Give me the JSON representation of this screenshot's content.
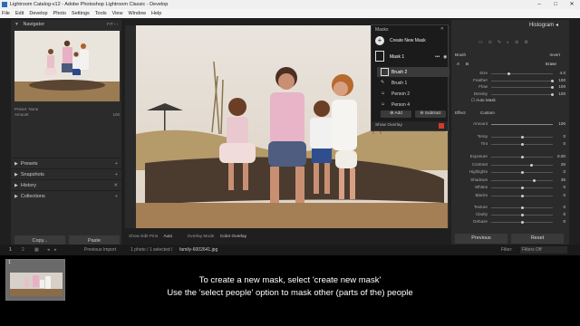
{
  "window": {
    "title": "Lightroom Catalog-v12 - Adobe Photoshop Lightroom Classic - Develop",
    "minimize": "–",
    "maximize": "□",
    "close": "✕"
  },
  "menu": [
    "File",
    "Edit",
    "Develop",
    "Photo",
    "Settings",
    "Tools",
    "View",
    "Window",
    "Help"
  ],
  "left_panel": {
    "navigator": "Navigator",
    "zoom_options": "FIT  ‹  ›",
    "preset_label": "Preset",
    "preset_value": "None",
    "preset_amount": "Amount",
    "preset_amount_value": "100",
    "sections": [
      "Presets",
      "Snapshots",
      "History",
      "Collections"
    ],
    "copy_button": "Copy...",
    "paste_button": "Paste"
  },
  "toolbar": {
    "show_edit_pins": "Show Edit Pins",
    "edit_pins_value": "Auto",
    "overlay_mode": "Overlay Mode",
    "overlay_mode_value": "Color Overlay"
  },
  "masks_panel": {
    "title": "Masks",
    "create_new": "Create New Mask",
    "items": [
      {
        "label": "Mask 1",
        "indent": 0
      },
      {
        "label": "Brush 2",
        "indent": 1
      },
      {
        "label": "Brush 1",
        "indent": 1
      },
      {
        "label": "Person 2",
        "indent": 1
      },
      {
        "label": "Person 4",
        "indent": 1
      }
    ],
    "add": "Add",
    "subtract": "Subtract",
    "show_overlay": "Show Overlay"
  },
  "right_panel": {
    "histogram": "Histogram",
    "brush_label": "Brush",
    "brush_mode": "Invert",
    "ab_a": "A",
    "ab_b": "B",
    "erase": "Erase",
    "brush_sliders": [
      {
        "label": "Size",
        "value": "4.0",
        "pos": 0.28
      },
      {
        "label": "Feather",
        "value": "100",
        "pos": 1.0
      },
      {
        "label": "Flow",
        "value": "100",
        "pos": 1.0
      },
      {
        "label": "Density",
        "value": "100",
        "pos": 1.0
      }
    ],
    "auto_mask": "Auto Mask",
    "effect_label": "Effect",
    "effect_value": "Custom",
    "amount_label": "Amount",
    "amount_value": "100",
    "sliders": [
      {
        "label": "Temp",
        "value": "0",
        "pos": 0.5
      },
      {
        "label": "Tint",
        "value": "0",
        "pos": 0.5
      },
      {
        "label": "Exposure",
        "value": "0.00",
        "pos": 0.5
      },
      {
        "label": "Contrast",
        "value": "29",
        "pos": 0.65
      },
      {
        "label": "Highlights",
        "value": "0",
        "pos": 0.5
      },
      {
        "label": "Shadows",
        "value": "39",
        "pos": 0.69
      },
      {
        "label": "Whites",
        "value": "0",
        "pos": 0.5
      },
      {
        "label": "Blacks",
        "value": "0",
        "pos": 0.5
      },
      {
        "label": "Texture",
        "value": "0",
        "pos": 0.5
      },
      {
        "label": "Clarity",
        "value": "0",
        "pos": 0.5
      },
      {
        "label": "Dehaze",
        "value": "0",
        "pos": 0.5
      }
    ],
    "previous": "Previous",
    "reset": "Reset"
  },
  "filmstrip_bar": {
    "page1": "1",
    "page2": "2",
    "previous_import": "Previous Import",
    "info": "1 photo / 1 selected /",
    "filename": "family-6002641.jpg",
    "filter_label": "Filter:",
    "filter_value": "Filters Off"
  },
  "thumbnail_badge": "1",
  "captions": [
    "To create a new mask, select 'create new mask'",
    "Use the 'select people' option to mask other (parts of the) people"
  ],
  "colors": {
    "accent_red": "#d33a2c",
    "panel_bg": "#2b2b2b",
    "masks_bg": "#1b1b1b"
  }
}
